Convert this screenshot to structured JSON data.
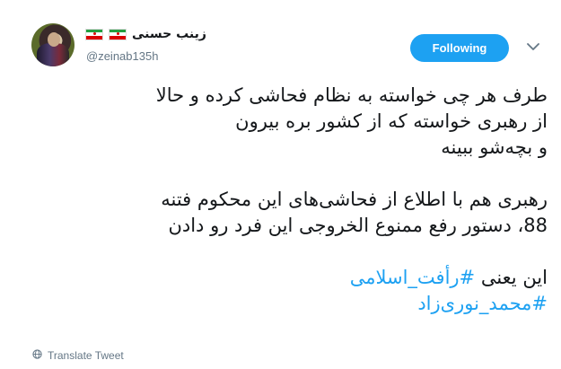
{
  "user": {
    "display_name": "زینب حسنی",
    "handle": "@zeinab135h"
  },
  "follow_button": {
    "label": "Following"
  },
  "tweet": {
    "paragraphs": [
      [
        "طرف هر چی خواسته به نظام فحاشی کرده و حالا",
        "از رهبری خواسته که از کشور بره بیرون",
        "و بچه‌شو ببینه"
      ],
      [
        "رهبری هم با اطلاع از فحاشی‌های این محکوم فتنه",
        "88، دستور رفع ممنوع الخروجی این فرد رو دادن"
      ]
    ],
    "last_line_prefix": "این یعنی ",
    "hashtags": [
      "#رأفت_اسلامی",
      "#محمد_نوری‌زاد"
    ]
  },
  "translate": {
    "label": "Translate Tweet"
  },
  "colors": {
    "accent": "#1da1f2",
    "text": "#14171a",
    "muted": "#657786"
  },
  "icons": [
    "chevron-down-icon",
    "globe-icon",
    "iran-flag-icon"
  ]
}
